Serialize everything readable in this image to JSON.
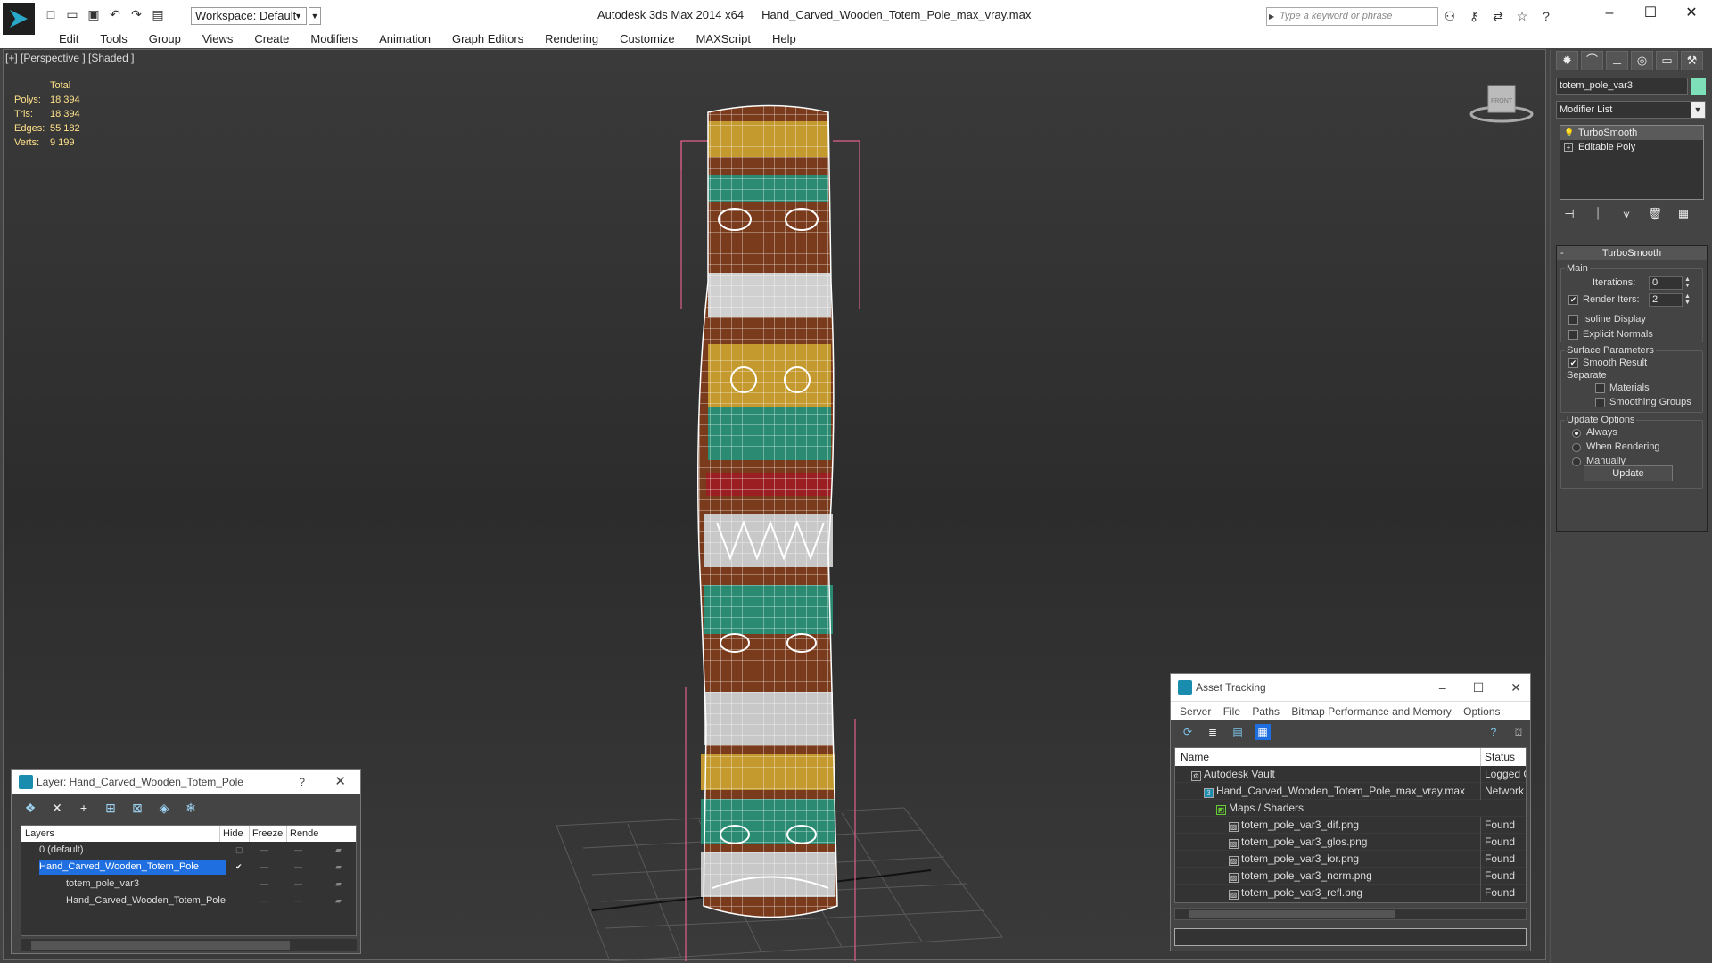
{
  "app": {
    "title": "Autodesk 3ds Max  2014 x64",
    "filename": "Hand_Carved_Wooden_Totem_Pole_max_vray.max",
    "workspace": "Workspace: Default",
    "search_placeholder": "Type a keyword or phrase"
  },
  "menu": [
    "Edit",
    "Tools",
    "Group",
    "Views",
    "Create",
    "Modifiers",
    "Animation",
    "Graph Editors",
    "Rendering",
    "Customize",
    "MAXScript",
    "Help"
  ],
  "viewport": {
    "label": "[+] [Perspective ] [Shaded ]",
    "stats_header": "Total",
    "stats": [
      {
        "k": "Polys:",
        "v": "18 394"
      },
      {
        "k": "Tris:",
        "v": "18 394"
      },
      {
        "k": "Edges:",
        "v": "55 182"
      },
      {
        "k": "Verts:",
        "v": "9 199"
      }
    ],
    "viewcube_label": "FRONT"
  },
  "command_panel": {
    "object_name": "totem_pole_var3",
    "object_color": "#7de0b8",
    "modifier_list": "Modifier List",
    "stack": [
      "TurboSmooth",
      "Editable Poly"
    ],
    "rollout_title": "TurboSmooth",
    "main_group": "Main",
    "iterations_label": "Iterations:",
    "iterations_value": "0",
    "render_iters_label": "Render Iters:",
    "render_iters_value": "2",
    "isoline_label": "Isoline Display",
    "explicit_label": "Explicit Normals",
    "surface_group": "Surface Parameters",
    "smooth_label": "Smooth Result",
    "separate_label": "Separate",
    "materials_label": "Materials",
    "smoothing_label": "Smoothing Groups",
    "update_group": "Update Options",
    "always_label": "Always",
    "when_rendering_label": "When Rendering",
    "manually_label": "Manually",
    "update_button": "Update"
  },
  "layer_window": {
    "title": "Layer: Hand_Carved_Wooden_Totem_Pole",
    "help": "?",
    "columns": [
      "Layers",
      "Hide",
      "Freeze",
      "Rende"
    ],
    "rows": [
      {
        "name": "0 (default)",
        "indent": 0
      },
      {
        "name": "Hand_Carved_Wooden_Totem_Pole",
        "indent": 0
      },
      {
        "name": "totem_pole_var3",
        "indent": 1
      },
      {
        "name": "Hand_Carved_Wooden_Totem_Pole",
        "indent": 1
      }
    ]
  },
  "asset_window": {
    "title": "Asset Tracking",
    "menu": [
      "Server",
      "File",
      "Paths",
      "Bitmap Performance and Memory",
      "Options"
    ],
    "columns": [
      "Name",
      "Status"
    ],
    "rows": [
      {
        "name": "Autodesk Vault",
        "status": "Logged Out",
        "indent": 1
      },
      {
        "name": "Hand_Carved_Wooden_Totem_Pole_max_vray.max",
        "status": "Network",
        "indent": 2
      },
      {
        "name": "Maps / Shaders",
        "status": "",
        "indent": 3
      },
      {
        "name": "totem_pole_var3_dif.png",
        "status": "Found",
        "indent": 4
      },
      {
        "name": "totem_pole_var3_glos.png",
        "status": "Found",
        "indent": 4
      },
      {
        "name": "totem_pole_var3_ior.png",
        "status": "Found",
        "indent": 4
      },
      {
        "name": "totem_pole_var3_norm.png",
        "status": "Found",
        "indent": 4
      },
      {
        "name": "totem_pole_var3_refl.png",
        "status": "Found",
        "indent": 4
      }
    ]
  }
}
